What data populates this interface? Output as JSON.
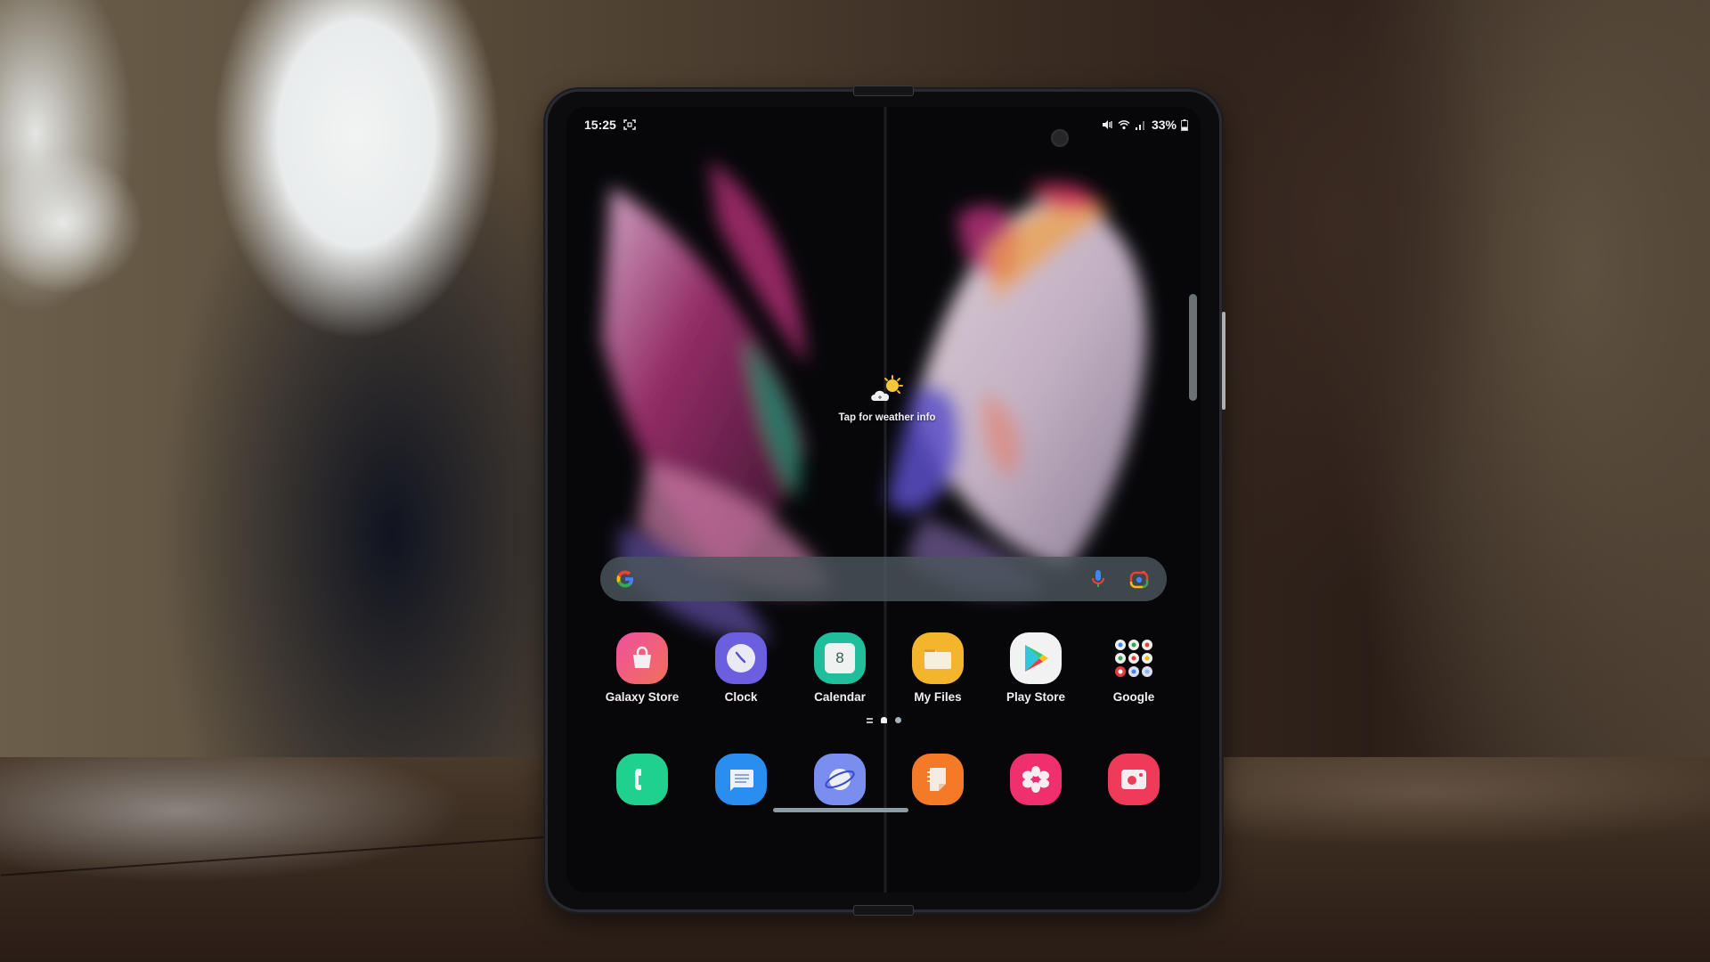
{
  "status_bar": {
    "time": "15:25",
    "left_icons": [
      "screenshot-icon"
    ],
    "right_icons": [
      "mute-icon",
      "wifi-icon",
      "signal-icon",
      "battery-icon"
    ],
    "battery_percent": "33%",
    "battery_level": 0.33
  },
  "weather_widget": {
    "icon": "partly-sunny-icon",
    "text": "Tap for weather info"
  },
  "search_bar": {
    "placeholder": "",
    "value": "",
    "google_logo": "google-g-icon",
    "voice_icon": "microphone-icon",
    "lens_icon": "google-lens-icon"
  },
  "apps": [
    {
      "name": "galaxy-store",
      "label": "Galaxy Store",
      "icon": "shopping-bag-icon",
      "color": "#e8487a"
    },
    {
      "name": "clock",
      "label": "Clock",
      "icon": "clock-icon",
      "color": "#6b5fe0"
    },
    {
      "name": "calendar",
      "label": "Calendar",
      "icon": "calendar-icon",
      "color": "#1fbf9c",
      "day": "8"
    },
    {
      "name": "my-files",
      "label": "My Files",
      "icon": "folder-icon",
      "color": "#f3b52c"
    },
    {
      "name": "play-store",
      "label": "Play Store",
      "icon": "play-store-icon",
      "color": "#f2f2f2"
    },
    {
      "name": "google",
      "label": "Google",
      "icon": "google-folder-icon",
      "color": "transparent"
    }
  ],
  "page_indicator": {
    "items": [
      "menu",
      "home",
      "page"
    ],
    "current": 1
  },
  "dock": [
    {
      "name": "phone",
      "icon": "phone-icon",
      "color": "#1fd08e"
    },
    {
      "name": "messages",
      "icon": "messages-icon",
      "color": "#2a8ef0"
    },
    {
      "name": "internet",
      "icon": "internet-planet-icon",
      "color": "#5f7df0"
    },
    {
      "name": "notes",
      "icon": "notes-icon",
      "color": "#f47a28"
    },
    {
      "name": "gallery",
      "icon": "gallery-flower-icon",
      "color": "#f0306e"
    },
    {
      "name": "camera",
      "icon": "camera-icon",
      "color": "#ef3a5a"
    }
  ]
}
